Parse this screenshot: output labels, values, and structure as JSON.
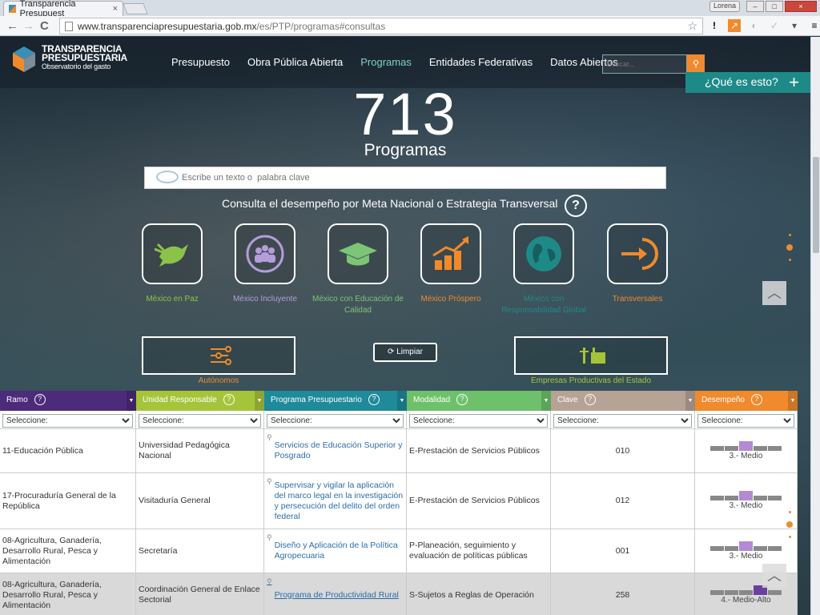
{
  "browser": {
    "tab_title": "Transparencia Presupuest",
    "close": "×",
    "user": "Lorena",
    "url_host": "www.transparenciapresupuestaria.gob.mx",
    "url_path": "/es/PTP/programas#consultas",
    "back": "←",
    "forward": "→",
    "reload": "C",
    "star": "☆",
    "menu": "≡"
  },
  "header": {
    "logo_line1": "TRANSPARENCIA",
    "logo_line2": "PRESUPUESTARIA",
    "logo_line3": "Observatorio del gasto",
    "menu": [
      "Presupuesto",
      "Obra Pública Abierta",
      "Programas",
      "Entidades Federativas",
      "Datos Abiertos"
    ],
    "active_menu": "Programas",
    "search_placeholder": "Buscar...",
    "que_es": "¿Qué es esto?"
  },
  "hero": {
    "count": "713",
    "count_label": "Programas",
    "keyword_placeholder": "Escribe un texto o  palabra clave",
    "consulta": "Consulta el desempeño por Meta Nacional o Estrategia Transversal",
    "help": "?"
  },
  "metas": [
    {
      "label": "México en Paz",
      "color": "#8bc34a",
      "icon": "dove-icon"
    },
    {
      "label": "México Incluyente",
      "color": "#b39ddb",
      "icon": "people-icon"
    },
    {
      "label": "México con Educación de Calidad",
      "color": "#7cc576",
      "icon": "graduation-cap-icon"
    },
    {
      "label": "México Próspero",
      "color": "#f08a2c",
      "icon": "growth-chart-icon"
    },
    {
      "label": "México con Responsabilidad Global",
      "color": "#1e8a88",
      "icon": "globe-icon"
    },
    {
      "label": "Transversales",
      "color": "#f08a2c",
      "icon": "arrow-circle-icon"
    }
  ],
  "extra": {
    "autonomos": "Autónomos",
    "limpiar": "Limpiar",
    "empresas": "Empresas Productivas del Estado",
    "autonomos_color": "#f08a2c",
    "empresas_color": "#a6c43a"
  },
  "table": {
    "headers": [
      {
        "label": "Ramo",
        "color": "#4b2b7a"
      },
      {
        "label": "Unidad Responsable",
        "color": "#a6c43a"
      },
      {
        "label": "Programa Presupuestario",
        "color": "#1e8a9a"
      },
      {
        "label": "Modalidad",
        "color": "#6ec06a"
      },
      {
        "label": "Clave",
        "color": "#b5a396"
      },
      {
        "label": "Desempeño",
        "color": "#f08a2c"
      }
    ],
    "filter_placeholder": "Seleccione:",
    "rows": [
      {
        "ramo": "11-Educación Pública",
        "unidad": "Universidad Pedagógica Nacional",
        "programa": "Servicios de Educación Superior y Posgrado",
        "modalidad": "E-Prestación de Servicios Públicos",
        "clave": "010",
        "desempeno": "3.- Medio",
        "level": 3
      },
      {
        "ramo": "17-Procuraduría General de la República",
        "unidad": "Visitaduría General",
        "programa": "Supervisar y vigilar la aplicación del marco legal en la investigación y persecución del delito del orden federal",
        "modalidad": "E-Prestación de Servicios Públicos",
        "clave": "012",
        "desempeno": "3.- Medio",
        "level": 3
      },
      {
        "ramo": "08-Agricultura, Ganadería, Desarrollo Rural, Pesca y Alimentación",
        "unidad": "Secretaría",
        "programa": "Diseño y Aplicación de la Política Agropecuaria",
        "modalidad": "P-Planeación, seguimiento y evaluación de políticas públicas",
        "clave": "001",
        "desempeno": "3.- Medio",
        "level": 3
      },
      {
        "ramo": "08-Agricultura, Ganadería, Desarrollo Rural, Pesca y Alimentación",
        "unidad": "Coordinación General de Enlace Sectorial",
        "programa": "Programa de Productividad Rural",
        "modalidad": "S-Sujetos a Reglas de Operación",
        "clave": "258",
        "desempeno": "4.- Medio-Alto",
        "level": 4
      }
    ]
  }
}
